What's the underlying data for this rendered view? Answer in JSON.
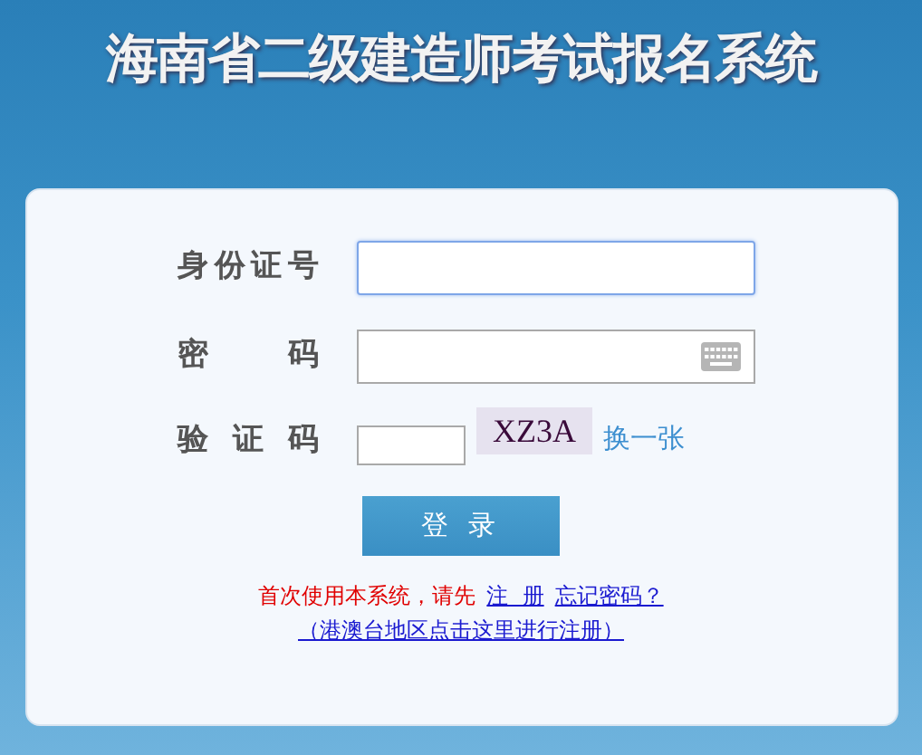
{
  "header": {
    "title": "海南省二级建造师考试报名系统"
  },
  "form": {
    "fields": [
      {
        "kind": "text",
        "label": "身份证号",
        "focused": true
      },
      {
        "kind": "password",
        "label": "密码",
        "focused": false
      },
      {
        "kind": "captcha",
        "label": "验证码",
        "focused": false,
        "captcha": "XZ3A",
        "refresh": "换一张"
      }
    ],
    "submit": "登 录",
    "notice": {
      "text": "首次使用本系统，请先",
      "register": "注  册",
      "forgot": "忘记密码？",
      "overseas": "（港澳台地区点击这里进行注册）"
    }
  }
}
